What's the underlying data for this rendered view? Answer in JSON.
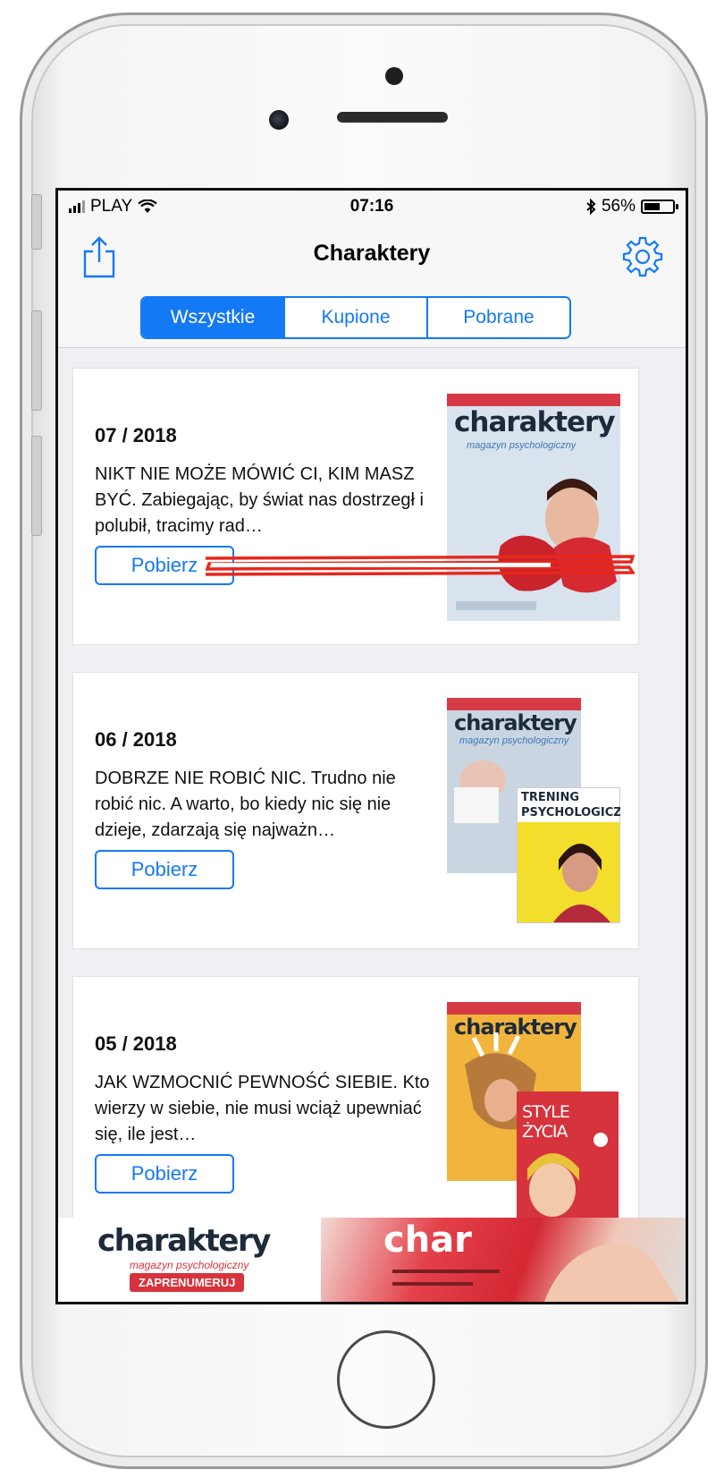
{
  "statusbar": {
    "carrier": "PLAY",
    "time": "07:16",
    "battery": "56%",
    "battery_level": 0.56
  },
  "navbar": {
    "title": "Charaktery"
  },
  "segments": [
    {
      "label": "Wszystkie",
      "active": true
    },
    {
      "label": "Kupione",
      "active": false
    },
    {
      "label": "Pobrane",
      "active": false
    }
  ],
  "issues": [
    {
      "date": "07 / 2018",
      "description": "NIKT NIE MOŻE MÓWIĆ CI, KIM MASZ BYĆ. Zabiegając, by świat nas dostrzegł i polubił, tracimy rad…",
      "button": "Pobierz",
      "cover_title": "charaktery",
      "cover_subtitle": "magazyn psychologiczny",
      "cover_color": "#d8e3ee"
    },
    {
      "date": "06 / 2018",
      "description": "DOBRZE NIE ROBIĆ NIC. Trudno nie robić nic. A warto, bo kiedy nic się nie dzieje, zdarzają się najważn…",
      "button": "Pobierz",
      "cover_title": "charaktery",
      "cover_subtitle": "magazyn psychologiczny",
      "cover_color": "#c9d6e2",
      "extra_title": "TRENING PSYCHOLOGICZNY"
    },
    {
      "date": "05 / 2018",
      "description": "JAK WZMOCNIĆ PEWNOŚĆ SIEBIE. Kto wierzy w siebie, nie musi wciąż upewniać się, ile jest…",
      "button": "Pobierz",
      "cover_title": "charaktery",
      "cover_subtitle": "",
      "cover_color": "#f1b43c",
      "extra_title": "STYLE ŻYCIA"
    }
  ],
  "banner": {
    "logo": "charaktery",
    "subtitle": "magazyn psychologiczny",
    "cta": "ZAPRENUMERUJ",
    "image_text": "char"
  },
  "colors": {
    "accent": "#1479f5",
    "brand_red": "#d6333c"
  }
}
